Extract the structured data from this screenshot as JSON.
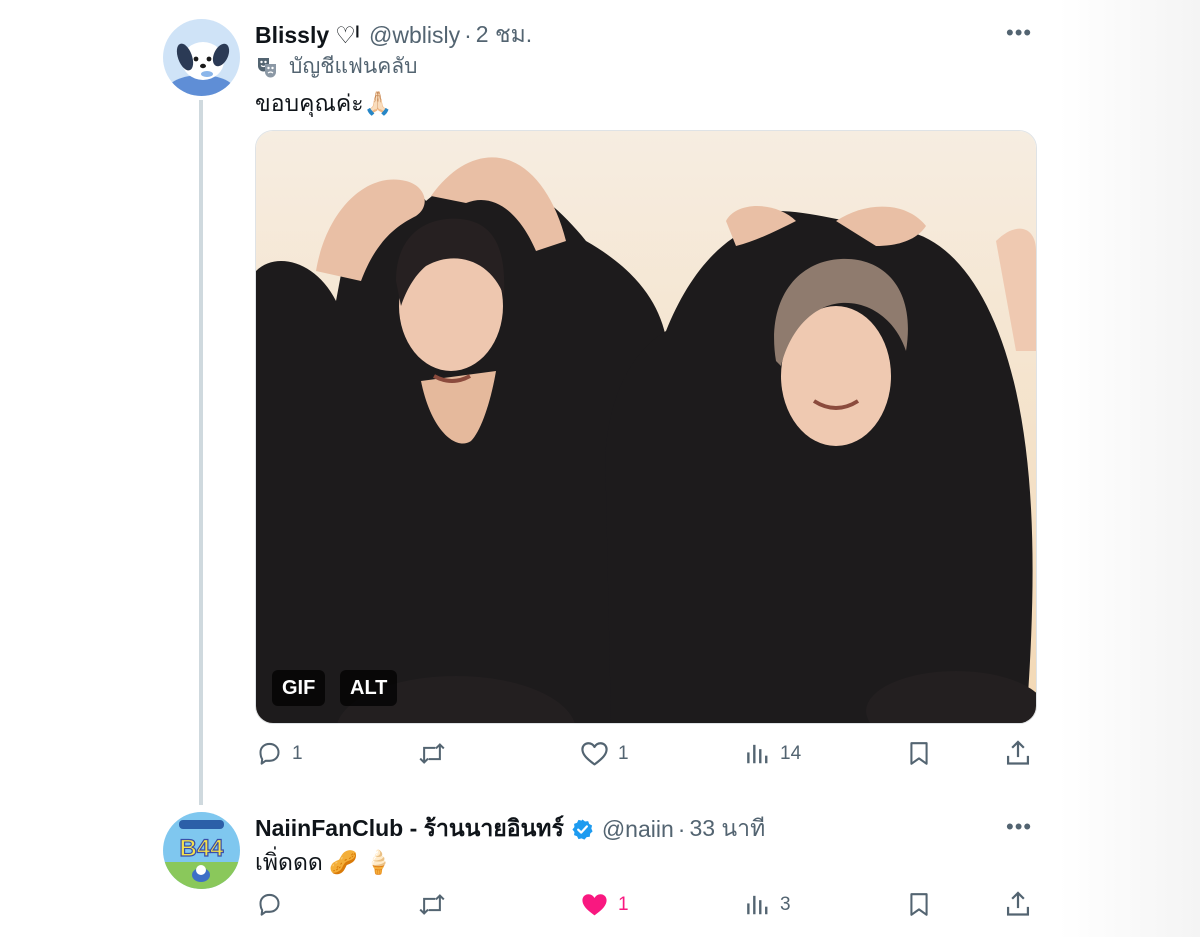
{
  "tweet1": {
    "display_name": "Blissly",
    "name_suffix": "♡ˡ",
    "handle": "@wblisly",
    "separator": "·",
    "time": "2 ชม.",
    "more": "•••",
    "fan_label": "บัญชีแฟนคลับ",
    "fan_icon": "theater-masks-icon",
    "text": "ขอบคุณค่ะ🙏🏻",
    "media": {
      "type": "gif",
      "gif_badge": "GIF",
      "alt_badge": "ALT"
    },
    "actions": {
      "replies": "1",
      "retweets": "",
      "likes": "1",
      "liked": false,
      "views": "14"
    }
  },
  "tweet2": {
    "display_name": "NaiinFanClub - ร้านนายอินทร์",
    "verified": true,
    "handle": "@naiin",
    "separator": "·",
    "time": "33 นาที",
    "more": "•••",
    "avatar_text": "B44",
    "text": "เพิ่ดดด 🥜 🍦",
    "actions": {
      "replies": "",
      "retweets": "",
      "likes": "1",
      "liked": true,
      "views": "3"
    }
  },
  "colors": {
    "like_active": "#f91880",
    "verified_blue": "#1d9bf0",
    "muted": "#536471",
    "thread_line": "#cfd9de"
  }
}
